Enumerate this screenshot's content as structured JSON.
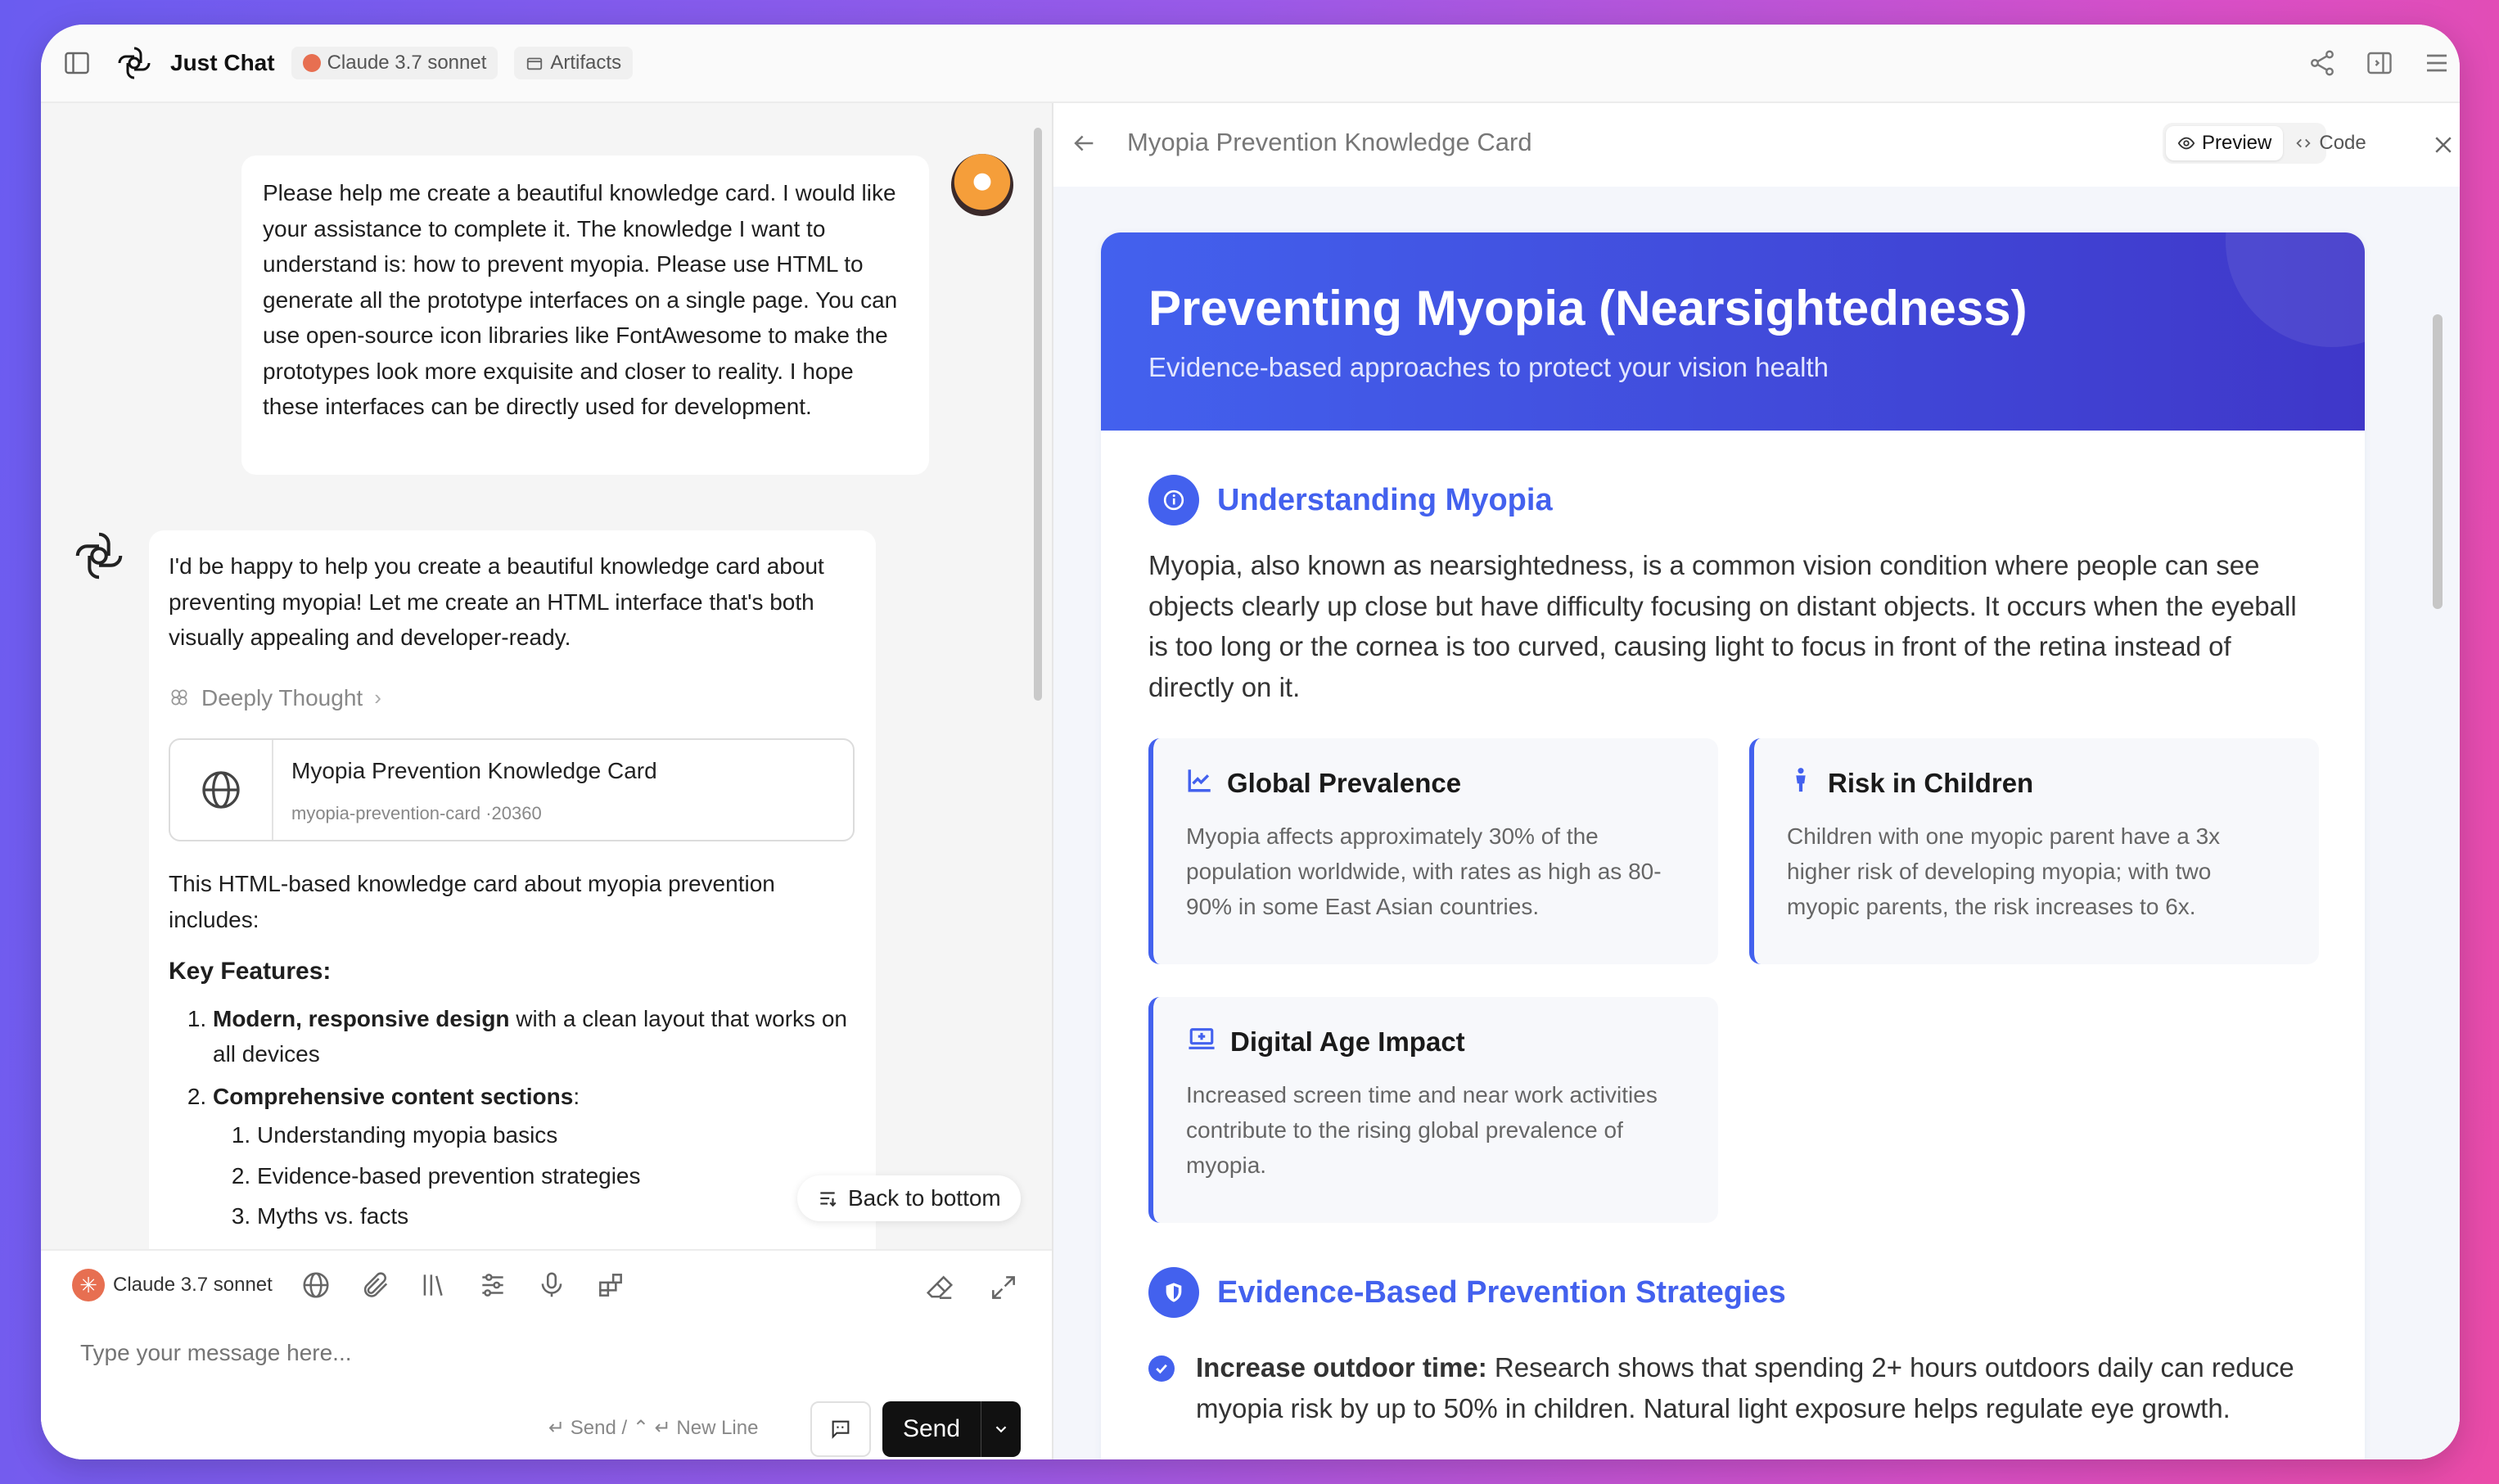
{
  "app": {
    "title": "Just Chat",
    "model_chip": "Claude 3.7 sonnet",
    "artifacts_chip": "Artifacts"
  },
  "chat": {
    "user_message": "Please help me create a beautiful knowledge card. I would like your assistance to complete it. The knowledge I want to understand is: how to prevent myopia. Please use HTML to generate all the prototype interfaces on a single page. You can use open-source icon libraries like FontAwesome to make the prototypes look more exquisite and closer to reality. I hope these interfaces can be directly used for development.",
    "bot_intro": "I'd be happy to help you create a beautiful knowledge card about preventing myopia! Let me create an HTML interface that's both visually appealing and developer-ready.",
    "thought_label": "Deeply Thought",
    "artifact": {
      "title": "Myopia Prevention Knowledge Card",
      "subtitle": "myopia-prevention-card ·20360"
    },
    "bot_p2": "This HTML-based knowledge card about myopia prevention includes:",
    "key_features_heading": "Key Features:",
    "features": [
      {
        "bold": "Modern, responsive design",
        "rest": " with a clean layout that works on all devices"
      },
      {
        "bold": "Comprehensive content sections",
        "rest": ":"
      }
    ],
    "subfeatures": [
      "Understanding myopia basics",
      "Evidence-based prevention strategies",
      "Myths vs. facts"
    ],
    "back_to_bottom": "Back to bottom"
  },
  "composer": {
    "model": "Claude 3.7 sonnet",
    "placeholder": "Type your message here...",
    "hint": "↵ Send / ⌃ ↵ New Line",
    "send_label": "Send"
  },
  "preview": {
    "header_title": "Myopia Prevention Knowledge Card",
    "preview_tab": "Preview",
    "code_tab": "Code",
    "card": {
      "title": "Preventing Myopia (Nearsightedness)",
      "subtitle": "Evidence-based approaches to protect your vision health",
      "section1_title": "Understanding Myopia",
      "section1_text": "Myopia, also known as nearsightedness, is a common vision condition where people can see objects clearly up close but have difficulty focusing on distant objects. It occurs when the eyeball is too long or the cornea is too curved, causing light to focus in front of the retina instead of directly on it.",
      "facts": [
        {
          "icon": "chart-line-icon",
          "title": "Global Prevalence",
          "text": "Myopia affects approximately 30% of the population worldwide, with rates as high as 80-90% in some East Asian countries."
        },
        {
          "icon": "child-icon",
          "title": "Risk in Children",
          "text": "Children with one myopic parent have a 3x higher risk of developing myopia; with two myopic parents, the risk increases to 6x."
        },
        {
          "icon": "laptop-icon",
          "title": "Digital Age Impact",
          "text": "Increased screen time and near work activities contribute to the rising global prevalence of myopia."
        }
      ],
      "section2_title": "Evidence-Based Prevention Strategies",
      "strategy1_bold": "Increase outdoor time:",
      "strategy1_text": " Research shows that spending 2+ hours outdoors daily can reduce myopia risk by up to 50% in children. Natural light exposure helps regulate eye growth."
    }
  },
  "colors": {
    "accent": "#4361ee",
    "accent_dark": "#3f37c9",
    "send_button": "#111111"
  }
}
